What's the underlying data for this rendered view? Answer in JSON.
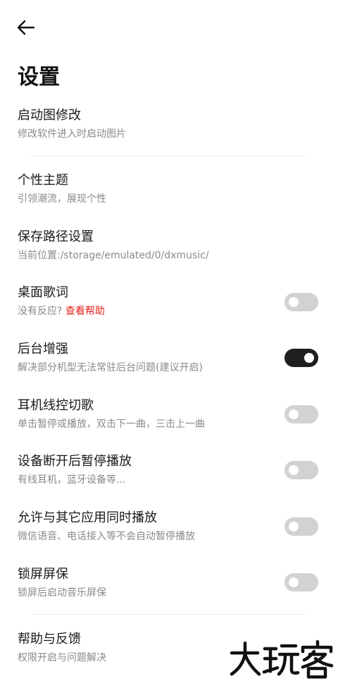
{
  "header": {
    "back_icon": "arrow-left-icon",
    "title": "设置"
  },
  "colors": {
    "accent_red": "#e0201b",
    "toggle_off": "#d2d2d2",
    "toggle_on": "#1f1f1f"
  },
  "items": [
    {
      "title": "启动图修改",
      "subtitle": "修改软件进入时启动图片"
    },
    {
      "title": "个性主题",
      "subtitle": "引领潮流，展现个性"
    },
    {
      "title": "保存路径设置",
      "subtitle": "当前位置:/storage/emulated/0/dxmusic/"
    },
    {
      "title": "桌面歌词",
      "subtitle": "没有反应?",
      "link": "查看帮助",
      "toggle_on": false
    },
    {
      "title": "后台增强",
      "subtitle": "解决部分机型无法常驻后台问题(建议开启)",
      "toggle_on": true
    },
    {
      "title": "耳机线控切歌",
      "subtitle": "单击暂停或播放，双击下一曲，三击上一曲",
      "toggle_on": false
    },
    {
      "title": "设备断开后暂停播放",
      "subtitle": "有线耳机，蓝牙设备等...",
      "toggle_on": false
    },
    {
      "title": "允许与其它应用同时播放",
      "subtitle": "微信语音、电话接入等不会自动暂停播放",
      "toggle_on": false
    },
    {
      "title": "锁屏屏保",
      "subtitle": "锁屏后启动音乐屏保",
      "toggle_on": false
    },
    {
      "title": "帮助与反馈",
      "subtitle": "权限开启与问题解决"
    }
  ],
  "watermark": {
    "text": "大玩客"
  }
}
